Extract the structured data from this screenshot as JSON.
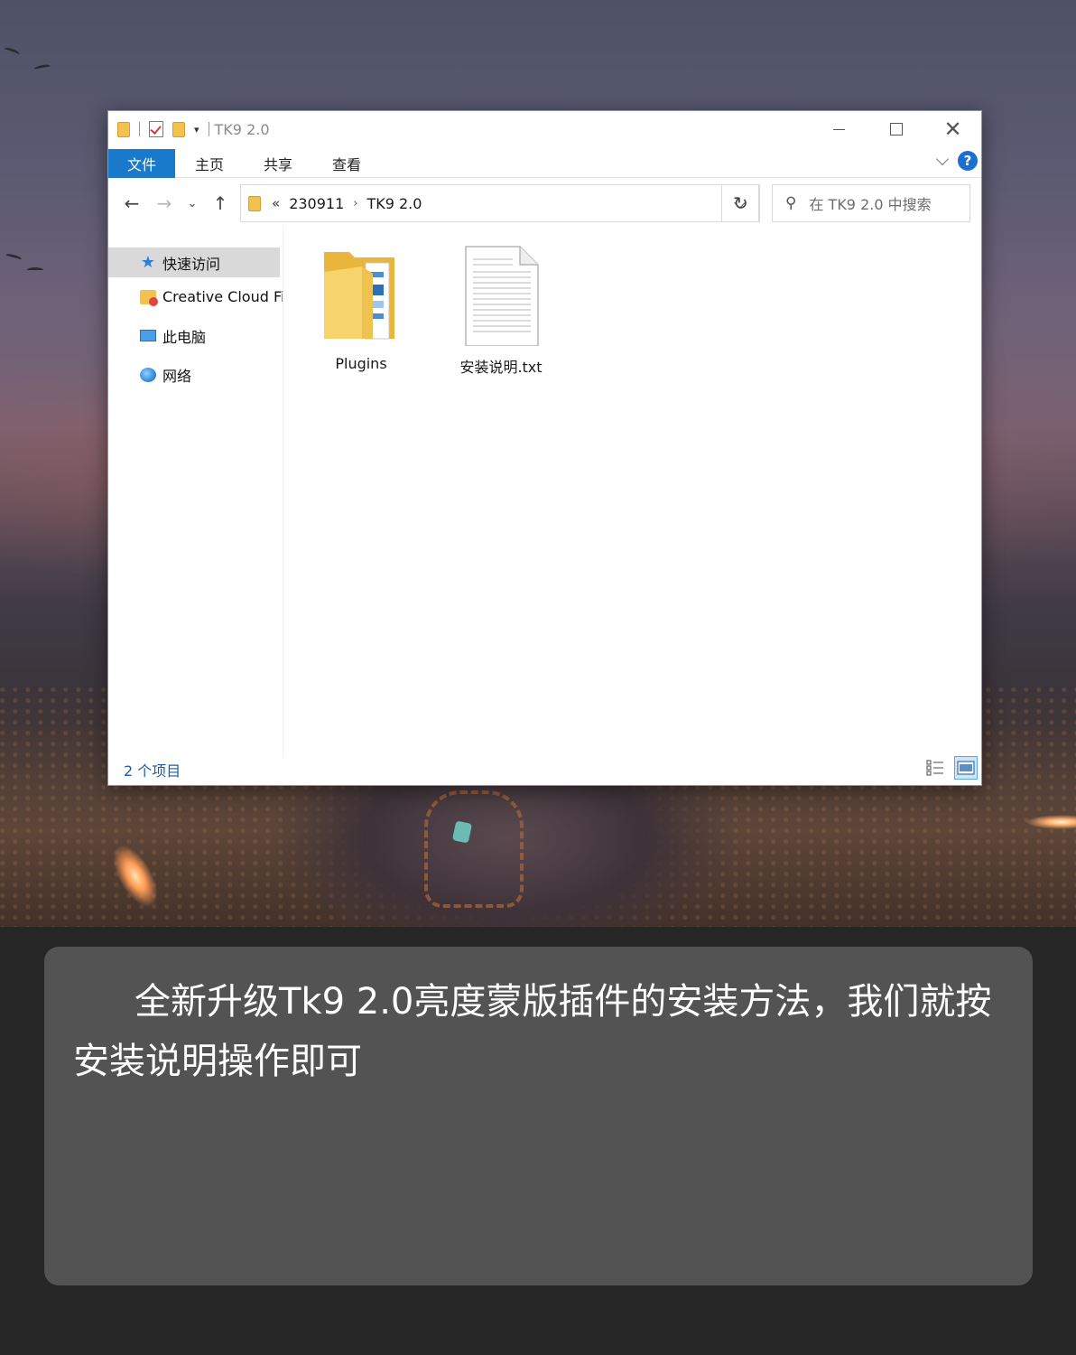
{
  "window": {
    "title": "TK9 2.0",
    "controls": {
      "minimize": "",
      "maximize": "",
      "close": "✕"
    }
  },
  "ribbon": {
    "tabs": [
      {
        "label": "文件",
        "active": true
      },
      {
        "label": "主页",
        "active": false
      },
      {
        "label": "共享",
        "active": false
      },
      {
        "label": "查看",
        "active": false
      }
    ],
    "help": "?"
  },
  "navigation": {
    "back": "←",
    "forward": "→",
    "recent": "⌄",
    "up": "↑",
    "breadcrumb_more": "«",
    "breadcrumb": [
      "230911",
      "TK9 2.0"
    ],
    "breadcrumb_separator": "›",
    "refresh": "↻",
    "search_placeholder": "在 TK9 2.0 中搜索"
  },
  "sidebar": {
    "items": [
      {
        "label": "快速访问",
        "icon": "star-icon",
        "selected": true
      },
      {
        "label": "Creative Cloud Fi",
        "icon": "creative-cloud-folder-icon",
        "selected": false
      },
      {
        "label": "此电脑",
        "icon": "computer-icon",
        "selected": false
      },
      {
        "label": "网络",
        "icon": "network-icon",
        "selected": false
      }
    ]
  },
  "files": [
    {
      "name": "Plugins",
      "icon": "folder-icon"
    },
    {
      "name": "安装说明.txt",
      "icon": "text-file-icon"
    }
  ],
  "status": {
    "item_count": "2 个项目"
  },
  "caption": {
    "text": "全新升级Tk9 2.0亮度蒙版插件的安装方法，我们就按安装说明操作即可"
  },
  "colors": {
    "accent": "#1979ca",
    "card_bg": "#535353",
    "page_bg": "#262626"
  }
}
